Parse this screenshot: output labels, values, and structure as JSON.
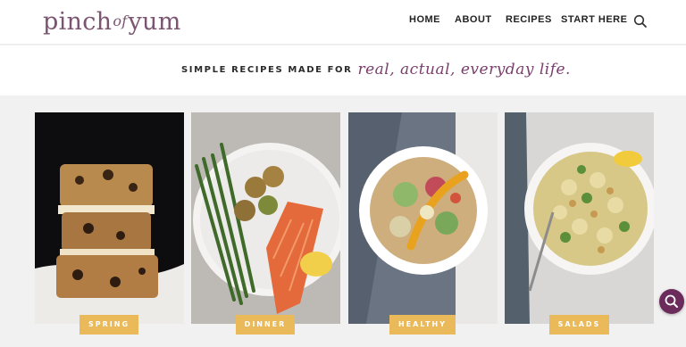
{
  "header": {
    "logo": {
      "part1": "pinch",
      "part2": "of",
      "part3": "yum"
    },
    "nav": [
      "HOME",
      "ABOUT",
      "RECIPES",
      "START HERE"
    ],
    "search_icon": "search-icon"
  },
  "tagline": {
    "caps": "SIMPLE RECIPES MADE FOR",
    "script": "real, actual, everyday life."
  },
  "categories": [
    {
      "label": "SPRING",
      "image": "stacked cookie bars"
    },
    {
      "label": "DINNER",
      "image": "salmon with asparagus and potatoes"
    },
    {
      "label": "HEALTHY",
      "image": "taco salad bowl"
    },
    {
      "label": "SALADS",
      "image": "pasta salad with chickpeas"
    }
  ],
  "colors": {
    "brand": "#7a5470",
    "tagline_accent": "#7a3d6c",
    "label_bg": "#e9b95a",
    "fab": "#6b2c5c"
  },
  "fab_icon": "search-icon"
}
